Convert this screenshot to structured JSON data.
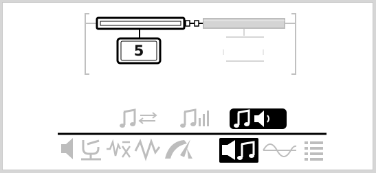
{
  "display": {
    "counter_value": "5",
    "screen_bg": "#ffffff",
    "outer_bg": "#d6d6d6",
    "active_color": "#000000",
    "inactive_color": "#bdbdbd",
    "disabled_track_color": "#cfcfcf"
  },
  "diagram": {
    "active_block": "signal-block",
    "inactive_block": "disabled-block"
  },
  "mode_row": {
    "items": [
      {
        "name": "music-transfer-mode",
        "icon": "music-arrows-icon",
        "selected": false
      },
      {
        "name": "music-levels-mode",
        "icon": "music-bars-icon",
        "selected": false
      },
      {
        "name": "music-speaker-mode",
        "icon": "music-speaker-icon",
        "selected": true
      }
    ]
  },
  "toolbar": {
    "items": [
      {
        "name": "volume-tool",
        "icon": "speaker-icon",
        "selected": false
      },
      {
        "name": "tuning-tool",
        "icon": "tuning-fork-icon",
        "selected": false
      },
      {
        "name": "noise-tool",
        "icon": "noise-wave-icon",
        "selected": false
      },
      {
        "name": "pulse-tool",
        "icon": "pulse-wave-icon",
        "selected": false
      },
      {
        "name": "gauge-tool",
        "icon": "gauge-icon",
        "selected": false
      },
      {
        "name": "speaker-music-tool",
        "icon": "speaker-music-icon",
        "selected": true
      },
      {
        "name": "sine-wave-tool",
        "icon": "sine-wave-icon",
        "selected": false
      },
      {
        "name": "list-tool",
        "icon": "list-icon",
        "selected": false
      }
    ]
  }
}
